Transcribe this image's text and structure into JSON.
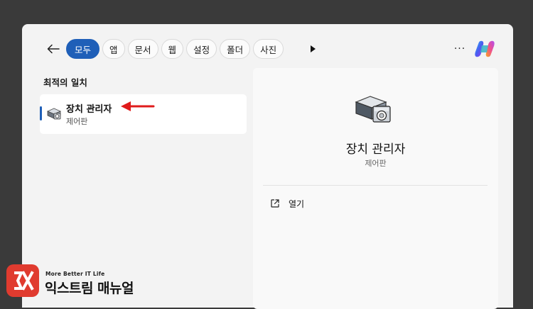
{
  "search": {
    "tabs": [
      {
        "label": "모두",
        "active": true
      },
      {
        "label": "앱",
        "active": false
      },
      {
        "label": "문서",
        "active": false
      },
      {
        "label": "웹",
        "active": false
      },
      {
        "label": "설정",
        "active": false
      },
      {
        "label": "폴더",
        "active": false
      },
      {
        "label": "사진",
        "active": false
      }
    ],
    "more_options_label": "···"
  },
  "results": {
    "section_title": "최적의 일치",
    "best_match": {
      "title": "장치 관리자",
      "subtitle": "제어판",
      "icon": "device-manager-icon"
    }
  },
  "details": {
    "title": "장치 관리자",
    "subtitle": "제어판",
    "actions": [
      {
        "label": "열기",
        "icon": "open-external-icon"
      }
    ]
  },
  "watermark": {
    "tagline": "More Better IT Life",
    "name": "익스트림 매뉴얼"
  },
  "colors": {
    "accent": "#1f5fb8",
    "annotation_arrow": "#e01b1b",
    "logo_red": "#e03b2f"
  }
}
